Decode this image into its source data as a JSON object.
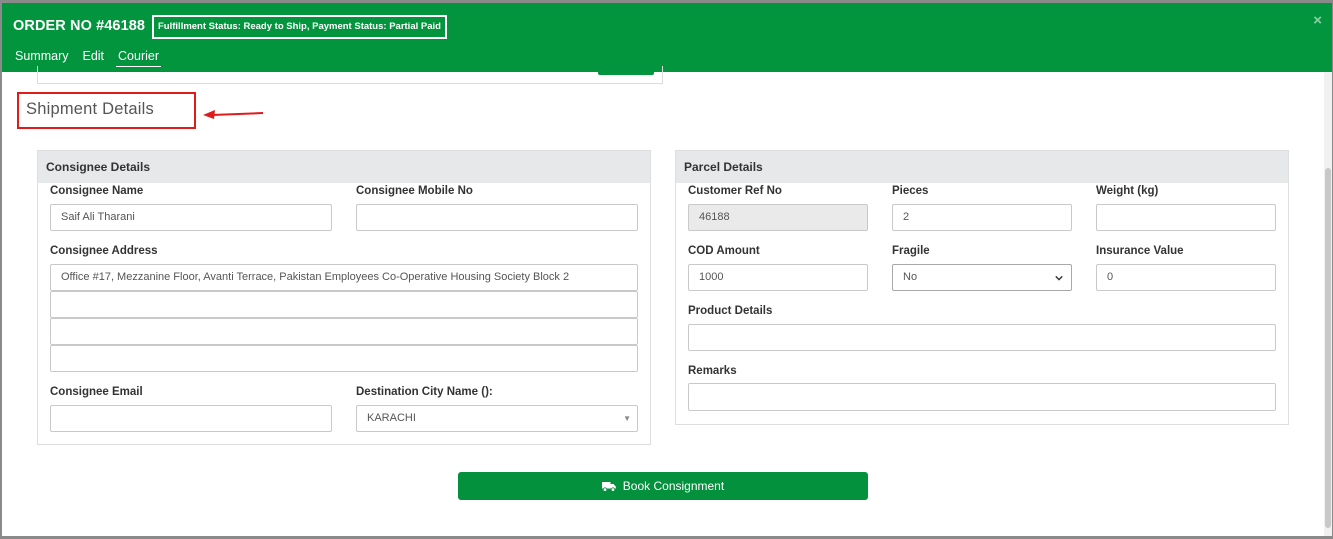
{
  "header": {
    "order_title": "ORDER NO #46188",
    "status_text": "Fulfillment Status: Ready to Ship,  Payment Status: Partial Paid",
    "close": "×",
    "tabs": [
      {
        "label": "Summary",
        "active": false
      },
      {
        "label": "Edit",
        "active": false
      },
      {
        "label": "Courier",
        "active": true
      }
    ]
  },
  "section_title": "Shipment Details",
  "consignee": {
    "heading": "Consignee Details",
    "name_label": "Consignee Name",
    "name_value": "Saif Ali Tharani",
    "mobile_label": "Consignee Mobile No",
    "mobile_value": "",
    "address_label": "Consignee Address",
    "address_lines": [
      "Office #17, Mezzanine Floor, Avanti Terrace, Pakistan Employees Co-Operative Housing Society Block 2",
      "",
      "",
      ""
    ],
    "email_label": "Consignee Email",
    "email_value": "",
    "city_label": "Destination City Name ():",
    "city_value": "KARACHI"
  },
  "parcel": {
    "heading": "Parcel Details",
    "ref_label": "Customer Ref No",
    "ref_value": "46188",
    "pieces_label": "Pieces",
    "pieces_value": "2",
    "weight_label": "Weight (kg)",
    "weight_value": "",
    "cod_label": "COD Amount",
    "cod_value": "1000",
    "fragile_label": "Fragile",
    "fragile_value": "No",
    "insurance_label": "Insurance Value",
    "insurance_value": "0",
    "product_label": "Product Details",
    "product_value": "",
    "remarks_label": "Remarks",
    "remarks_value": ""
  },
  "book_button": "Book Consignment",
  "colors": {
    "header_green": "#02953e",
    "highlight_red": "#e01b1b"
  },
  "icons": [
    "close-icon",
    "arrow-left-icon",
    "chevron-down-icon",
    "truck-icon"
  ]
}
